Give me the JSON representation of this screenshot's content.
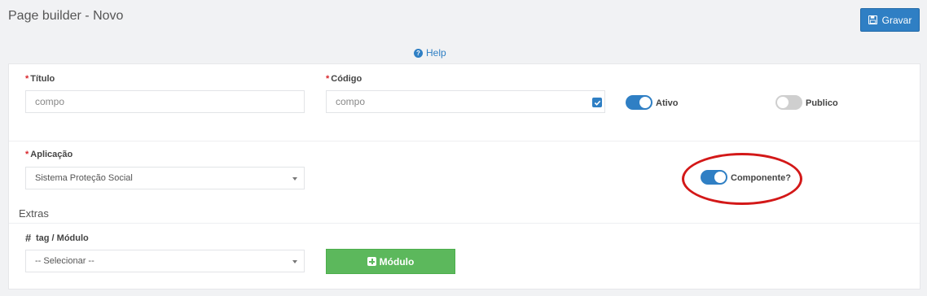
{
  "header": {
    "title": "Page builder - Novo",
    "save_label": "Gravar"
  },
  "help": {
    "label": "Help"
  },
  "form": {
    "titulo": {
      "label": "Título",
      "value": "compo"
    },
    "codigo": {
      "label": "Código",
      "value": "compo",
      "checked": true
    },
    "ativo": {
      "label": "Ativo",
      "on": true
    },
    "publico": {
      "label": "Publico",
      "on": false
    },
    "aplicacao": {
      "label": "Aplicação",
      "value": "Sistema Proteção Social"
    },
    "componente": {
      "label": "Componente?",
      "on": true
    },
    "extras": {
      "title": "Extras"
    },
    "tag_modulo": {
      "hash": "#",
      "label": "tag / Módulo",
      "placeholder": "-- Selecionar --"
    },
    "modulo_button": {
      "label": "Módulo"
    }
  },
  "colors": {
    "primary": "#2f7fc4",
    "success": "#5cb85c",
    "required": "#d9262c",
    "annotation": "#d31818"
  }
}
